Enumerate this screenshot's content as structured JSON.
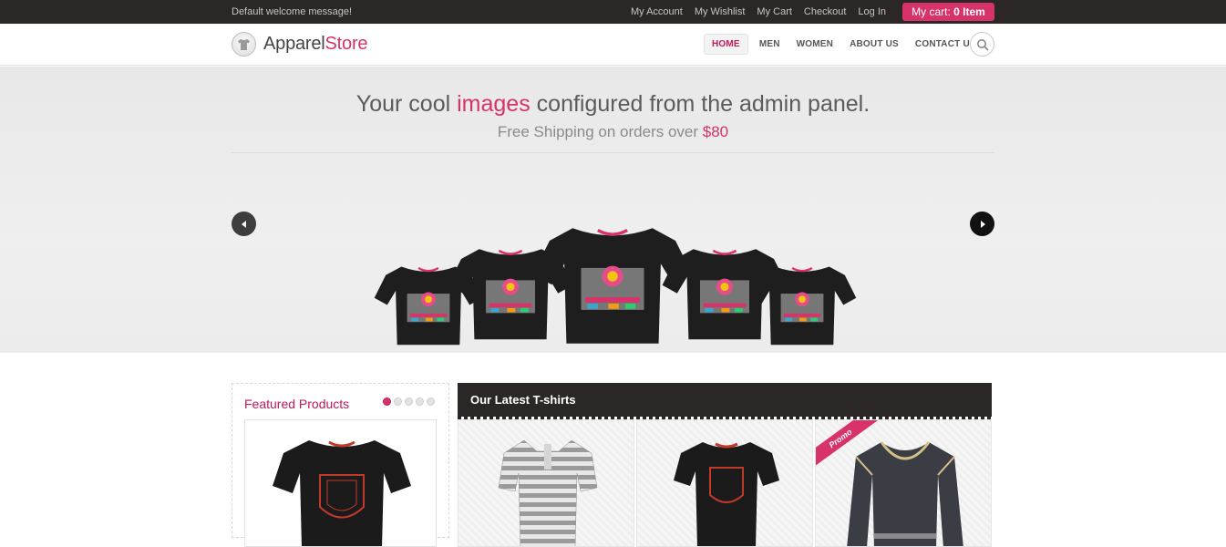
{
  "topbar": {
    "welcome": "Default welcome message!",
    "links": [
      "My Account",
      "My Wishlist",
      "My Cart",
      "Checkout",
      "Log In"
    ],
    "cart_prefix": "My cart:",
    "cart_count": "0 Item"
  },
  "header": {
    "logo_part1": "Apparel",
    "logo_part2": "Store",
    "nav": [
      "HOME",
      "MEN",
      "WOMEN",
      "ABOUT US",
      "CONTACT US"
    ],
    "active_nav": "HOME"
  },
  "hero": {
    "headline_pre": "Your cool ",
    "headline_accent": "images",
    "headline_post": " configured from the admin panel.",
    "sub_pre": "Free Shipping on orders over ",
    "sub_accent": "$80"
  },
  "featured": {
    "title": "Featured Products",
    "pages": 5,
    "current_page": 1
  },
  "latest": {
    "title": "Our Latest T-shirts",
    "promo_label": "Promo"
  },
  "colors": {
    "accent": "#d7326a",
    "dark": "#2b2726"
  }
}
